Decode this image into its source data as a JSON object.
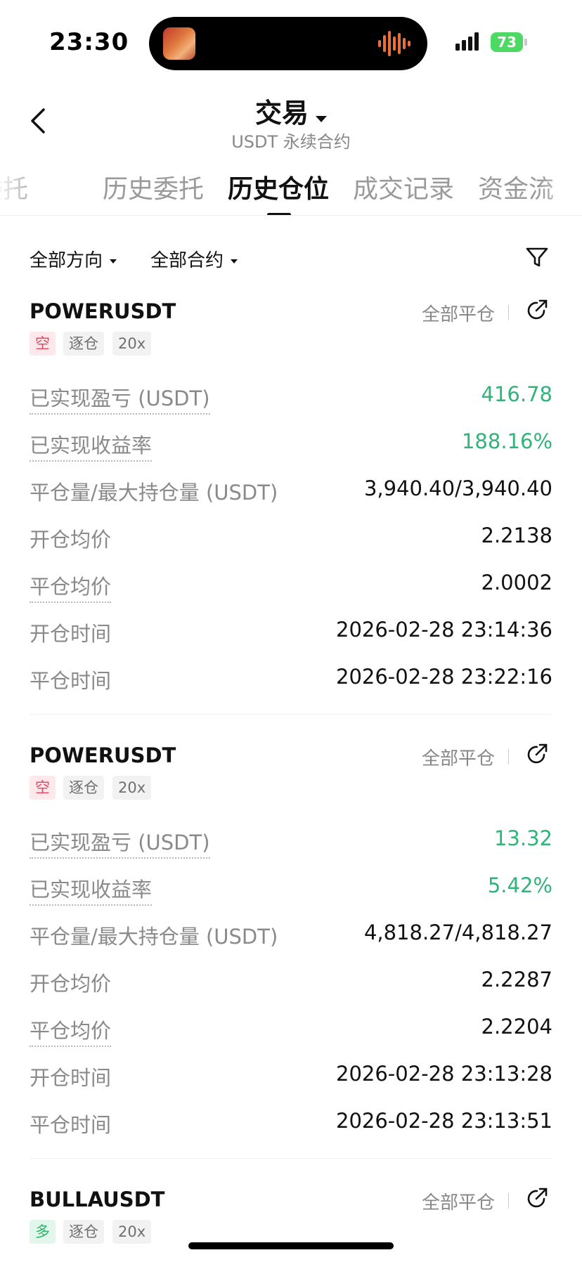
{
  "status_bar": {
    "time": "23:30",
    "battery": "73"
  },
  "header": {
    "title": "交易",
    "subtitle": "USDT 永续合约"
  },
  "tabs": [
    {
      "label": "委托"
    },
    {
      "label": "历史委托"
    },
    {
      "label": "历史仓位",
      "active": true
    },
    {
      "label": "成交记录"
    },
    {
      "label": "资金流"
    }
  ],
  "filters": {
    "direction": "全部方向",
    "contract": "全部合约"
  },
  "labels": {
    "realized_pnl": "已实现盈亏 (USDT)",
    "realized_roi": "已实现收益率",
    "close_max": "平仓量/最大持仓量 (USDT)",
    "open_avg": "开仓均价",
    "close_avg": "平仓均价",
    "open_time": "开仓时间",
    "close_time": "平仓时间",
    "close_all": "全部平仓"
  },
  "positions": [
    {
      "symbol": "POWERUSDT",
      "side": "空",
      "margin_mode": "逐仓",
      "leverage": "20x",
      "realized_pnl": "416.78",
      "realized_roi": "188.16%",
      "close_max": "3,940.40/3,940.40",
      "open_avg": "2.2138",
      "close_avg": "2.0002",
      "open_time": "2026-02-28 23:14:36",
      "close_time": "2026-02-28 23:22:16"
    },
    {
      "symbol": "POWERUSDT",
      "side": "空",
      "margin_mode": "逐仓",
      "leverage": "20x",
      "realized_pnl": "13.32",
      "realized_roi": "5.42%",
      "close_max": "4,818.27/4,818.27",
      "open_avg": "2.2287",
      "close_avg": "2.2204",
      "open_time": "2026-02-28 23:13:28",
      "close_time": "2026-02-28 23:13:51"
    },
    {
      "symbol": "BULLAUSDT",
      "side": "多",
      "margin_mode": "逐仓",
      "leverage": "20x"
    }
  ],
  "colors": {
    "profit_green": "#32b37a",
    "short_red": "#e34860",
    "long_green": "#2fb36b"
  }
}
